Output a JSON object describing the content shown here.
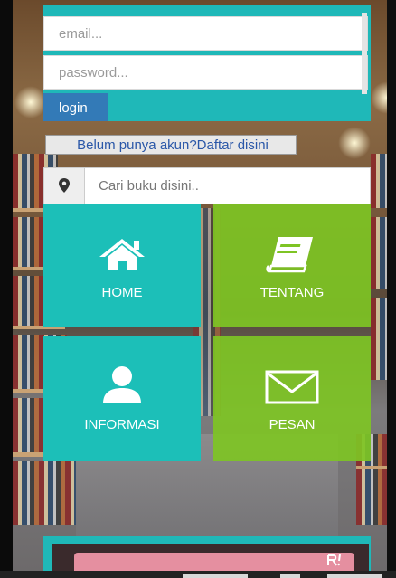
{
  "login": {
    "email_placeholder": "email...",
    "password_placeholder": "password...",
    "login_label": "login"
  },
  "register": {
    "label": "Belum punya akun?Daftar disini"
  },
  "search": {
    "placeholder": "Cari buku disini.."
  },
  "menu": {
    "home": "HOME",
    "tentang": "TENTANG",
    "informasi": "INFORMASI",
    "pesan": "PESAN"
  },
  "icons": {
    "search": "map-marker-icon",
    "home": "house-icon",
    "tentang": "book-icon",
    "informasi": "user-icon",
    "pesan": "envelope-icon"
  },
  "colors": {
    "teal": "#1cbfb8",
    "green": "#7ec424",
    "login_blue": "#337ab7"
  }
}
